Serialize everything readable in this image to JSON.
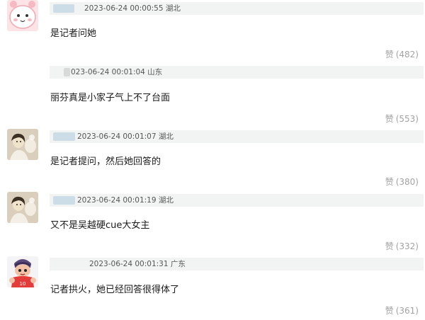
{
  "comments": [
    {
      "meta": "2023-06-24 00:00:55 湖北",
      "text": "是记者问她",
      "like_label": "赞",
      "like_count": "(482)",
      "avatar": "pink-cartoon-avatar"
    },
    {
      "meta": "023-06-24 00:01:04 山东",
      "text": "丽芬真是小家子气上不了台面",
      "like_label": "赞",
      "like_count": "(553)",
      "avatar": "none"
    },
    {
      "meta": "2023-06-24 00:01:07 湖北",
      "text": "是记者提问，然后她回答的",
      "like_label": "赞",
      "like_count": "(380)",
      "avatar": "vintage-photo-avatar"
    },
    {
      "meta": "2023-06-24 00:01:19 湖北",
      "text": "又不是吴越硬cue大女主",
      "like_label": "赞",
      "like_count": "(332)",
      "avatar": "vintage-photo-avatar"
    },
    {
      "meta": "2023-06-24 00:01:31 广东",
      "text": "记者拱火，她已经回答很得体了",
      "like_label": "赞",
      "like_count": "(361)",
      "avatar": "cartoon-player-avatar"
    }
  ]
}
